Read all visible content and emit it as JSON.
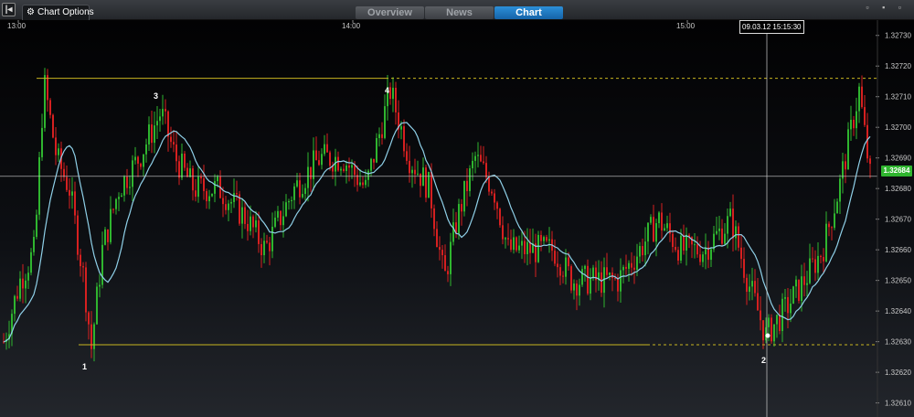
{
  "toolbar": {
    "collapse_icon": "panel-toggle-icon",
    "collapse_label": "|◂",
    "chart_options_icon": "gear-icon",
    "chart_options_label": "Chart Options",
    "tabs": [
      {
        "label": "Overview",
        "active": false
      },
      {
        "label": "News",
        "active": false
      },
      {
        "label": "Chart",
        "active": true
      }
    ],
    "window_controls": "▫ ▪ ▫"
  },
  "chart": {
    "crosshair_time": "09.03.12 15:15:30",
    "current_price": "1.32684",
    "colors": {
      "up": "#2fb52f",
      "down": "#d62020",
      "moving_average": "#8fd0e8",
      "trendline": "#c8b520",
      "crosshair": "#cfcfcf",
      "tab_active": "#1f7dc8"
    }
  },
  "chart_data": {
    "type": "candlestick",
    "x_ticks": [
      "13:00",
      "14:00",
      "15:00"
    ],
    "y_ticks": [
      "1.32730",
      "1.32720",
      "1.32710",
      "1.32700",
      "1.32690",
      "1.32680",
      "1.32670",
      "1.32660",
      "1.32650",
      "1.32640",
      "1.32630",
      "1.32620",
      "1.32610"
    ],
    "ylim": [
      1.32606,
      1.32735
    ],
    "markers": [
      {
        "label": "1",
        "price": 1.32628
      },
      {
        "label": "2",
        "price": 1.32631
      },
      {
        "label": "3",
        "price": 1.32713
      },
      {
        "label": "4",
        "price": 1.32714
      }
    ],
    "resistance_level": 1.32716,
    "support_level": 1.32629,
    "crosshair_price": 1.32684,
    "grid": false
  }
}
